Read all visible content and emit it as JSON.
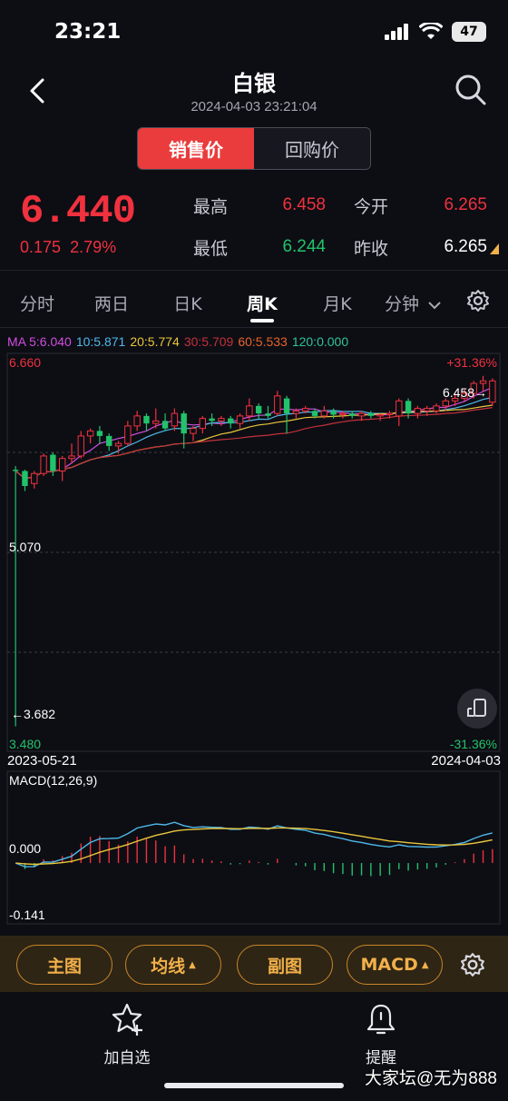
{
  "status": {
    "time": "23:21",
    "battery": "47"
  },
  "header": {
    "title": "白银",
    "timestamp": "2024-04-03 23:21:04"
  },
  "price_type": {
    "active": "销售价",
    "inactive": "回购价"
  },
  "quote": {
    "price": "6.440",
    "change": "0.175",
    "change_pct": "2.79%",
    "high_label": "最高",
    "high": "6.458",
    "open_label": "今开",
    "open": "6.265",
    "low_label": "最低",
    "low": "6.244",
    "prev_close_label": "昨收",
    "prev_close": "6.265"
  },
  "tabs": [
    "分时",
    "两日",
    "日K",
    "周K",
    "月K",
    "分钟"
  ],
  "active_tab": "周K",
  "ma_legend": [
    {
      "text": "MA 5:6.040",
      "color": "#d04de0"
    },
    {
      "text": "10:5.871",
      "color": "#4fb8ea"
    },
    {
      "text": "20:5.774",
      "color": "#e9c53a"
    },
    {
      "text": "30:5.709",
      "color": "#c2313a"
    },
    {
      "text": "60:5.533",
      "color": "#e8632a"
    },
    {
      "text": "120:0.000",
      "color": "#2fc39a"
    }
  ],
  "chart": {
    "axis_top_left": "6.660",
    "axis_top_right": "+31.36%",
    "axis_bottom_left": "3.480",
    "axis_bottom_right": "-31.36%",
    "max_marker": "6.458→",
    "min_marker": "←3.682",
    "level_label": "5.070",
    "date_start": "2023-05-21",
    "date_end": "2024-04-03",
    "macd_label": "MACD(12,26,9)",
    "macd_zero": "0.000",
    "macd_min": "-0.141"
  },
  "chart_data": {
    "type": "candlestick",
    "period": "weekly",
    "ylim": [
      3.48,
      6.66
    ],
    "x_start": "2023-05-21",
    "x_end": "2024-04-03",
    "candles": [
      [
        5.73,
        5.76,
        3.68,
        5.72
      ],
      [
        5.72,
        5.73,
        5.56,
        5.6
      ],
      [
        5.62,
        5.72,
        5.58,
        5.7
      ],
      [
        5.7,
        5.86,
        5.68,
        5.84
      ],
      [
        5.85,
        5.87,
        5.68,
        5.72
      ],
      [
        5.72,
        5.84,
        5.64,
        5.82
      ],
      [
        5.82,
        5.94,
        5.78,
        5.84
      ],
      [
        5.84,
        6.04,
        5.82,
        6.0
      ],
      [
        6.0,
        6.06,
        5.94,
        6.04
      ],
      [
        6.04,
        6.08,
        5.94,
        6.0
      ],
      [
        6.0,
        6.02,
        5.88,
        5.92
      ],
      [
        5.92,
        5.96,
        5.86,
        5.94
      ],
      [
        5.94,
        6.12,
        5.92,
        6.08
      ],
      [
        6.08,
        6.2,
        6.04,
        6.16
      ],
      [
        6.16,
        6.18,
        6.04,
        6.1
      ],
      [
        6.1,
        6.22,
        6.06,
        6.12
      ],
      [
        6.12,
        6.18,
        6.04,
        6.06
      ],
      [
        6.08,
        6.22,
        6.04,
        6.18
      ],
      [
        6.18,
        6.2,
        5.9,
        6.02
      ],
      [
        6.02,
        6.08,
        5.96,
        6.06
      ],
      [
        6.06,
        6.16,
        6.02,
        6.14
      ],
      [
        6.14,
        6.18,
        6.08,
        6.12
      ],
      [
        6.12,
        6.16,
        6.08,
        6.14
      ],
      [
        6.14,
        6.16,
        6.06,
        6.1
      ],
      [
        6.1,
        6.18,
        6.06,
        6.16
      ],
      [
        6.16,
        6.3,
        6.12,
        6.24
      ],
      [
        6.24,
        6.26,
        6.14,
        6.18
      ],
      [
        6.18,
        6.24,
        6.14,
        6.16
      ],
      [
        6.18,
        6.36,
        6.16,
        6.32
      ],
      [
        6.3,
        6.32,
        6.02,
        6.18
      ],
      [
        6.18,
        6.22,
        6.14,
        6.2
      ],
      [
        6.2,
        6.24,
        6.18,
        6.22
      ],
      [
        6.2,
        6.22,
        6.14,
        6.16
      ],
      [
        6.16,
        6.24,
        6.14,
        6.2
      ],
      [
        6.2,
        6.22,
        6.14,
        6.17
      ],
      [
        6.17,
        6.2,
        6.14,
        6.18
      ],
      [
        6.18,
        6.2,
        6.14,
        6.16
      ],
      [
        6.16,
        6.2,
        6.12,
        6.18
      ],
      [
        6.18,
        6.2,
        6.14,
        6.16
      ],
      [
        6.16,
        6.18,
        6.12,
        6.17
      ],
      [
        6.17,
        6.2,
        6.14,
        6.18
      ],
      [
        6.16,
        6.3,
        6.08,
        6.28
      ],
      [
        6.28,
        6.3,
        6.14,
        6.18
      ],
      [
        6.18,
        6.24,
        6.14,
        6.22
      ],
      [
        6.2,
        6.24,
        6.16,
        6.22
      ],
      [
        6.2,
        6.26,
        6.18,
        6.24
      ],
      [
        6.24,
        6.3,
        6.2,
        6.28
      ],
      [
        6.28,
        6.34,
        6.24,
        6.3
      ],
      [
        6.3,
        6.38,
        6.28,
        6.34
      ],
      [
        6.34,
        6.44,
        6.3,
        6.42
      ],
      [
        6.42,
        6.48,
        6.36,
        6.44
      ],
      [
        6.27,
        6.46,
        6.24,
        6.44
      ]
    ],
    "macd_ylim": [
      -0.15,
      0.23
    ]
  },
  "toolbar": {
    "main_chart": "主图",
    "ma": "均线",
    "sub_chart": "副图",
    "indicator": "MACD"
  },
  "nav": {
    "watchlist": "加自选",
    "alert": "提醒"
  },
  "watermark": "大家坛@无为888",
  "colors": {
    "up": "#f0313e",
    "down": "#22c26b",
    "accent": "#ea3c3c",
    "toolbar_gold": "#f2b04a"
  }
}
